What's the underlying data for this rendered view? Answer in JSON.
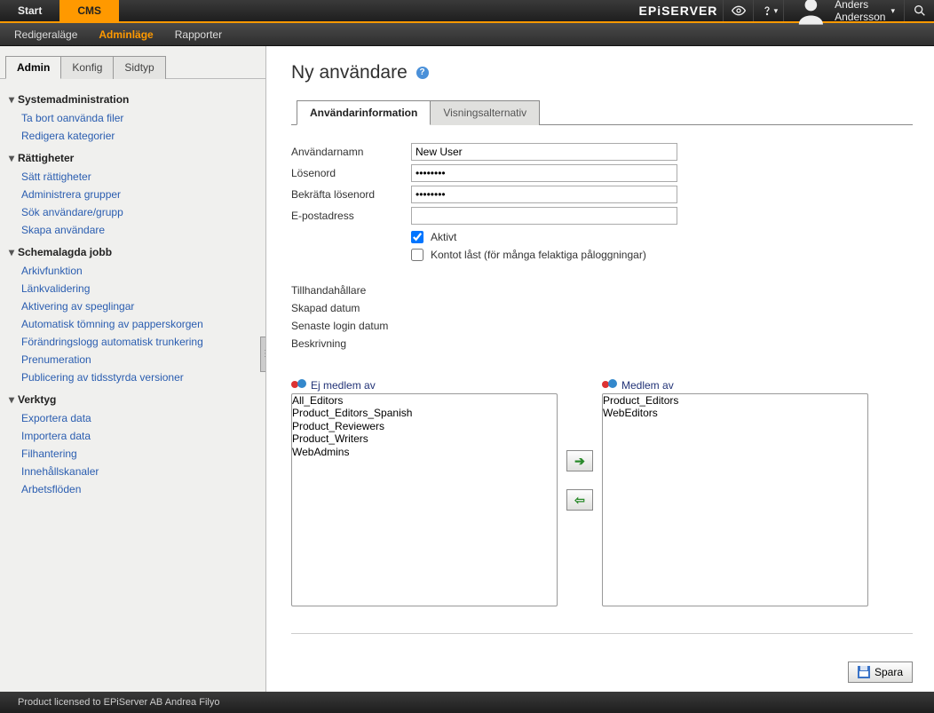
{
  "topnav": {
    "start": "Start",
    "cms": "CMS"
  },
  "brand": "EPiSERVER",
  "user_name": "Anders Andersson",
  "subnav": {
    "edit": "Redigeraläge",
    "admin": "Adminläge",
    "reports": "Rapporter"
  },
  "sidetabs": {
    "admin": "Admin",
    "config": "Konfig",
    "pagetype": "Sidtyp"
  },
  "nav": {
    "sysadmin": {
      "title": "Systemadministration",
      "items": [
        "Ta bort oanvända filer",
        "Redigera kategorier"
      ]
    },
    "rights": {
      "title": "Rättigheter",
      "items": [
        "Sätt rättigheter",
        "Administrera grupper",
        "Sök användare/grupp",
        "Skapa användare"
      ]
    },
    "scheduled": {
      "title": "Schemalagda jobb",
      "items": [
        "Arkivfunktion",
        "Länkvalidering",
        "Aktivering av speglingar",
        "Automatisk tömning av papperskorgen",
        "Förändringslogg automatisk trunkering",
        "Prenumeration",
        "Publicering av tidsstyrda versioner"
      ]
    },
    "tools": {
      "title": "Verktyg",
      "items": [
        "Exportera data",
        "Importera data",
        "Filhantering",
        "Innehållskanaler",
        "Arbetsflöden"
      ]
    }
  },
  "page_title": "Ny användare",
  "tabs": {
    "info": "Användarinformation",
    "display": "Visningsalternativ"
  },
  "form": {
    "username_label": "Användarnamn",
    "username_value": "New User",
    "password_label": "Lösenord",
    "password_value": "••••••••",
    "confirm_label": "Bekräfta lösenord",
    "confirm_value": "••••••••",
    "email_label": "E-postadress",
    "email_value": "",
    "active_label": "Aktivt",
    "locked_label": "Kontot låst (för många felaktiga påloggningar)"
  },
  "meta": {
    "provider": "Tillhandahållare",
    "created": "Skapad datum",
    "lastlogin": "Senaste login datum",
    "description": "Beskrivning"
  },
  "groups": {
    "not_member_label": "Ej medlem av",
    "member_label": "Medlem av",
    "not_member": [
      "All_Editors",
      "Product_Editors_Spanish",
      "Product_Reviewers",
      "Product_Writers",
      "WebAdmins"
    ],
    "member": [
      "Product_Editors",
      "WebEditors"
    ]
  },
  "save_label": "Spara",
  "footer": "Product licensed to EPiServer AB Andrea Filyo"
}
